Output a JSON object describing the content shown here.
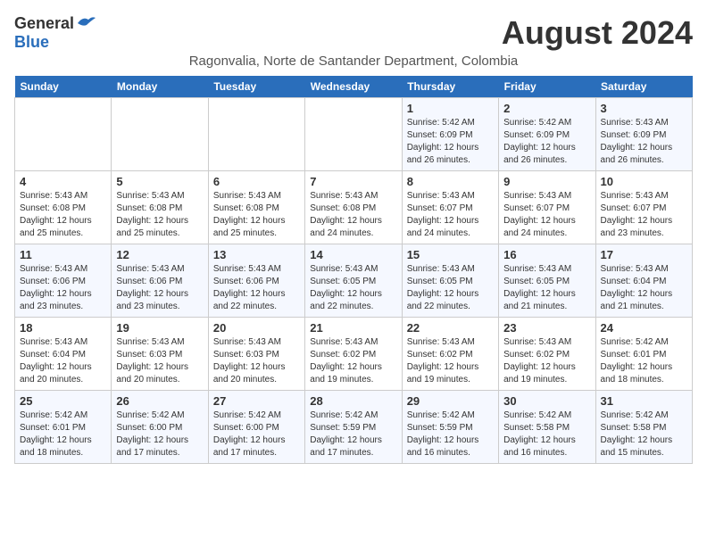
{
  "header": {
    "logo_general": "General",
    "logo_blue": "Blue",
    "month_year": "August 2024",
    "location": "Ragonvalia, Norte de Santander Department, Colombia"
  },
  "weekdays": [
    "Sunday",
    "Monday",
    "Tuesday",
    "Wednesday",
    "Thursday",
    "Friday",
    "Saturday"
  ],
  "weeks": [
    [
      {
        "day": "",
        "sunrise": "",
        "sunset": "",
        "daylight": ""
      },
      {
        "day": "",
        "sunrise": "",
        "sunset": "",
        "daylight": ""
      },
      {
        "day": "",
        "sunrise": "",
        "sunset": "",
        "daylight": ""
      },
      {
        "day": "",
        "sunrise": "",
        "sunset": "",
        "daylight": ""
      },
      {
        "day": "1",
        "sunrise": "Sunrise: 5:42 AM",
        "sunset": "Sunset: 6:09 PM",
        "daylight": "Daylight: 12 hours and 26 minutes."
      },
      {
        "day": "2",
        "sunrise": "Sunrise: 5:42 AM",
        "sunset": "Sunset: 6:09 PM",
        "daylight": "Daylight: 12 hours and 26 minutes."
      },
      {
        "day": "3",
        "sunrise": "Sunrise: 5:43 AM",
        "sunset": "Sunset: 6:09 PM",
        "daylight": "Daylight: 12 hours and 26 minutes."
      }
    ],
    [
      {
        "day": "4",
        "sunrise": "Sunrise: 5:43 AM",
        "sunset": "Sunset: 6:08 PM",
        "daylight": "Daylight: 12 hours and 25 minutes."
      },
      {
        "day": "5",
        "sunrise": "Sunrise: 5:43 AM",
        "sunset": "Sunset: 6:08 PM",
        "daylight": "Daylight: 12 hours and 25 minutes."
      },
      {
        "day": "6",
        "sunrise": "Sunrise: 5:43 AM",
        "sunset": "Sunset: 6:08 PM",
        "daylight": "Daylight: 12 hours and 25 minutes."
      },
      {
        "day": "7",
        "sunrise": "Sunrise: 5:43 AM",
        "sunset": "Sunset: 6:08 PM",
        "daylight": "Daylight: 12 hours and 24 minutes."
      },
      {
        "day": "8",
        "sunrise": "Sunrise: 5:43 AM",
        "sunset": "Sunset: 6:07 PM",
        "daylight": "Daylight: 12 hours and 24 minutes."
      },
      {
        "day": "9",
        "sunrise": "Sunrise: 5:43 AM",
        "sunset": "Sunset: 6:07 PM",
        "daylight": "Daylight: 12 hours and 24 minutes."
      },
      {
        "day": "10",
        "sunrise": "Sunrise: 5:43 AM",
        "sunset": "Sunset: 6:07 PM",
        "daylight": "Daylight: 12 hours and 23 minutes."
      }
    ],
    [
      {
        "day": "11",
        "sunrise": "Sunrise: 5:43 AM",
        "sunset": "Sunset: 6:06 PM",
        "daylight": "Daylight: 12 hours and 23 minutes."
      },
      {
        "day": "12",
        "sunrise": "Sunrise: 5:43 AM",
        "sunset": "Sunset: 6:06 PM",
        "daylight": "Daylight: 12 hours and 23 minutes."
      },
      {
        "day": "13",
        "sunrise": "Sunrise: 5:43 AM",
        "sunset": "Sunset: 6:06 PM",
        "daylight": "Daylight: 12 hours and 22 minutes."
      },
      {
        "day": "14",
        "sunrise": "Sunrise: 5:43 AM",
        "sunset": "Sunset: 6:05 PM",
        "daylight": "Daylight: 12 hours and 22 minutes."
      },
      {
        "day": "15",
        "sunrise": "Sunrise: 5:43 AM",
        "sunset": "Sunset: 6:05 PM",
        "daylight": "Daylight: 12 hours and 22 minutes."
      },
      {
        "day": "16",
        "sunrise": "Sunrise: 5:43 AM",
        "sunset": "Sunset: 6:05 PM",
        "daylight": "Daylight: 12 hours and 21 minutes."
      },
      {
        "day": "17",
        "sunrise": "Sunrise: 5:43 AM",
        "sunset": "Sunset: 6:04 PM",
        "daylight": "Daylight: 12 hours and 21 minutes."
      }
    ],
    [
      {
        "day": "18",
        "sunrise": "Sunrise: 5:43 AM",
        "sunset": "Sunset: 6:04 PM",
        "daylight": "Daylight: 12 hours and 20 minutes."
      },
      {
        "day": "19",
        "sunrise": "Sunrise: 5:43 AM",
        "sunset": "Sunset: 6:03 PM",
        "daylight": "Daylight: 12 hours and 20 minutes."
      },
      {
        "day": "20",
        "sunrise": "Sunrise: 5:43 AM",
        "sunset": "Sunset: 6:03 PM",
        "daylight": "Daylight: 12 hours and 20 minutes."
      },
      {
        "day": "21",
        "sunrise": "Sunrise: 5:43 AM",
        "sunset": "Sunset: 6:02 PM",
        "daylight": "Daylight: 12 hours and 19 minutes."
      },
      {
        "day": "22",
        "sunrise": "Sunrise: 5:43 AM",
        "sunset": "Sunset: 6:02 PM",
        "daylight": "Daylight: 12 hours and 19 minutes."
      },
      {
        "day": "23",
        "sunrise": "Sunrise: 5:43 AM",
        "sunset": "Sunset: 6:02 PM",
        "daylight": "Daylight: 12 hours and 19 minutes."
      },
      {
        "day": "24",
        "sunrise": "Sunrise: 5:42 AM",
        "sunset": "Sunset: 6:01 PM",
        "daylight": "Daylight: 12 hours and 18 minutes."
      }
    ],
    [
      {
        "day": "25",
        "sunrise": "Sunrise: 5:42 AM",
        "sunset": "Sunset: 6:01 PM",
        "daylight": "Daylight: 12 hours and 18 minutes."
      },
      {
        "day": "26",
        "sunrise": "Sunrise: 5:42 AM",
        "sunset": "Sunset: 6:00 PM",
        "daylight": "Daylight: 12 hours and 17 minutes."
      },
      {
        "day": "27",
        "sunrise": "Sunrise: 5:42 AM",
        "sunset": "Sunset: 6:00 PM",
        "daylight": "Daylight: 12 hours and 17 minutes."
      },
      {
        "day": "28",
        "sunrise": "Sunrise: 5:42 AM",
        "sunset": "Sunset: 5:59 PM",
        "daylight": "Daylight: 12 hours and 17 minutes."
      },
      {
        "day": "29",
        "sunrise": "Sunrise: 5:42 AM",
        "sunset": "Sunset: 5:59 PM",
        "daylight": "Daylight: 12 hours and 16 minutes."
      },
      {
        "day": "30",
        "sunrise": "Sunrise: 5:42 AM",
        "sunset": "Sunset: 5:58 PM",
        "daylight": "Daylight: 12 hours and 16 minutes."
      },
      {
        "day": "31",
        "sunrise": "Sunrise: 5:42 AM",
        "sunset": "Sunset: 5:58 PM",
        "daylight": "Daylight: 12 hours and 15 minutes."
      }
    ]
  ]
}
